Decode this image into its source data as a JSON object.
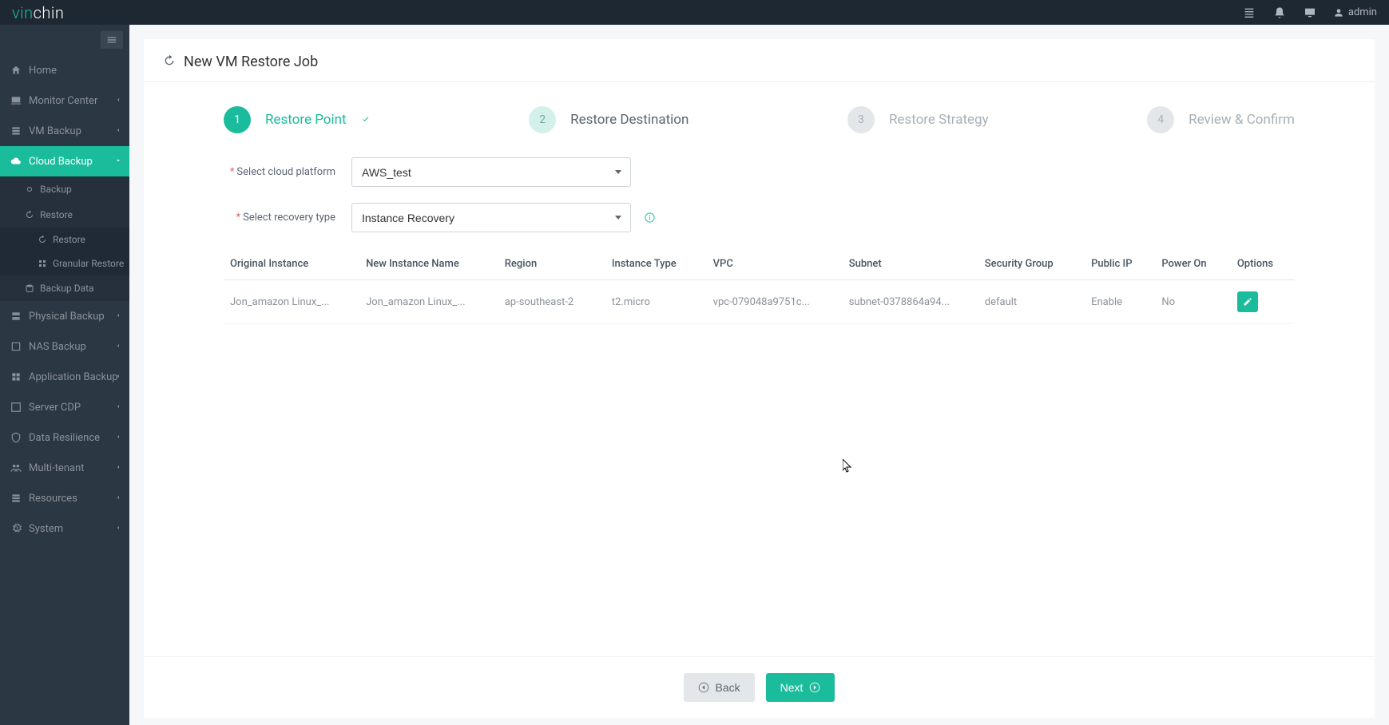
{
  "brand": {
    "part1": "vin",
    "part2": "chin"
  },
  "header": {
    "user": "admin"
  },
  "sidebar": {
    "items": [
      {
        "label": "Home",
        "icon": "home"
      },
      {
        "label": "Monitor Center",
        "icon": "monitor",
        "expandable": true
      },
      {
        "label": "VM Backup",
        "icon": "vm",
        "expandable": true
      },
      {
        "label": "Cloud Backup",
        "icon": "cloud",
        "expandable": true,
        "active": true
      },
      {
        "label": "Physical Backup",
        "icon": "physical",
        "expandable": true
      },
      {
        "label": "NAS Backup",
        "icon": "nas",
        "expandable": true
      },
      {
        "label": "Application Backup",
        "icon": "app",
        "expandable": true
      },
      {
        "label": "Server CDP",
        "icon": "cdp",
        "expandable": true
      },
      {
        "label": "Data Resilience",
        "icon": "resilience",
        "expandable": true
      },
      {
        "label": "Multi-tenant",
        "icon": "tenant",
        "expandable": true
      },
      {
        "label": "Resources",
        "icon": "resources",
        "expandable": true
      },
      {
        "label": "System",
        "icon": "system",
        "expandable": true
      }
    ],
    "cloudBackupSub": [
      {
        "label": "Backup"
      },
      {
        "label": "Restore",
        "expanded": true
      },
      {
        "label": "Backup Data"
      }
    ],
    "restoreSub": [
      {
        "label": "Restore"
      },
      {
        "label": "Granular Restore"
      }
    ]
  },
  "page": {
    "title": "New VM Restore Job",
    "steps": [
      {
        "num": "1",
        "label": "Restore Point",
        "state": "done"
      },
      {
        "num": "2",
        "label": "Restore Destination",
        "state": "current"
      },
      {
        "num": "3",
        "label": "Restore Strategy",
        "state": "pending"
      },
      {
        "num": "4",
        "label": "Review & Confirm",
        "state": "pending"
      }
    ],
    "form": {
      "platformLabel": "Select cloud platform",
      "platformValue": "AWS_test",
      "recoveryLabel": "Select recovery type",
      "recoveryValue": "Instance Recovery"
    },
    "table": {
      "headers": [
        "Original Instance",
        "New Instance Name",
        "Region",
        "Instance Type",
        "VPC",
        "Subnet",
        "Security Group",
        "Public IP",
        "Power On",
        "Options"
      ],
      "rows": [
        {
          "original": "Jon_amazon Linux_...",
          "newName": "Jon_amazon Linux_...",
          "region": "ap-southeast-2",
          "instanceType": "t2.micro",
          "vpc": "vpc-079048a9751c...",
          "subnet": "subnet-0378864a94...",
          "secGroup": "default",
          "publicIp": "Enable",
          "powerOn": "No"
        }
      ]
    },
    "buttons": {
      "back": "Back",
      "next": "Next"
    }
  }
}
